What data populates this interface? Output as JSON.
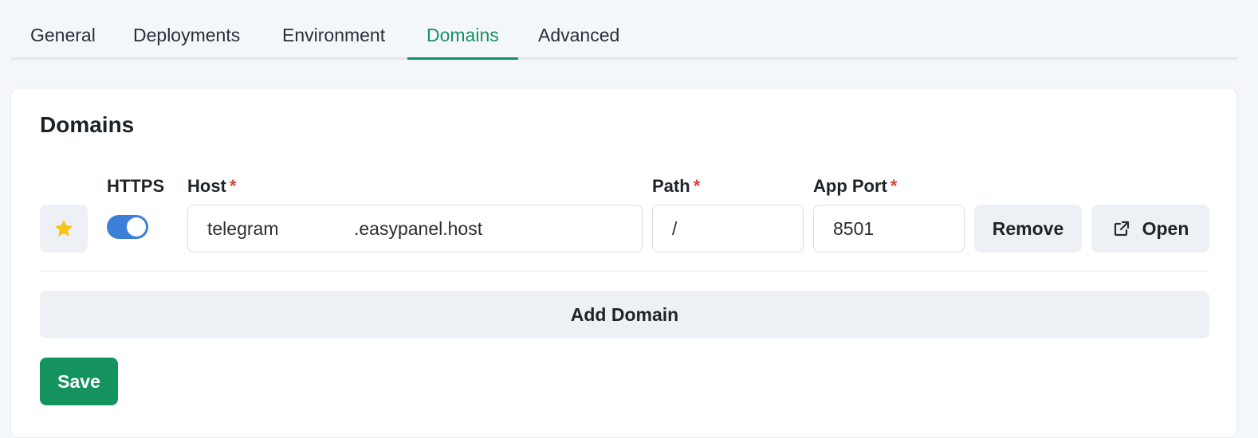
{
  "tabs": [
    {
      "label": "General",
      "active": false
    },
    {
      "label": "Deployments",
      "active": false
    },
    {
      "label": "Environment",
      "active": false
    },
    {
      "label": "Domains",
      "active": true
    },
    {
      "label": "Advanced",
      "active": false
    }
  ],
  "card": {
    "title": "Domains",
    "labels": {
      "https": "HTTPS",
      "host": "Host",
      "path": "Path",
      "app_port": "App Port",
      "required_mark": "*"
    },
    "domain_row": {
      "primary_icon": "star-icon",
      "https_enabled": true,
      "host_prefix": "telegram",
      "host_suffix": ".easypanel.host",
      "path": "/",
      "app_port": "8501",
      "remove_label": "Remove",
      "open_label": "Open",
      "open_icon": "external-link-icon"
    },
    "add_domain_label": "Add Domain",
    "save_label": "Save"
  },
  "colors": {
    "accent": "#189065",
    "save": "#14935f",
    "toggle": "#3b7fd9",
    "star": "#f5c518",
    "required": "#d6433a"
  }
}
